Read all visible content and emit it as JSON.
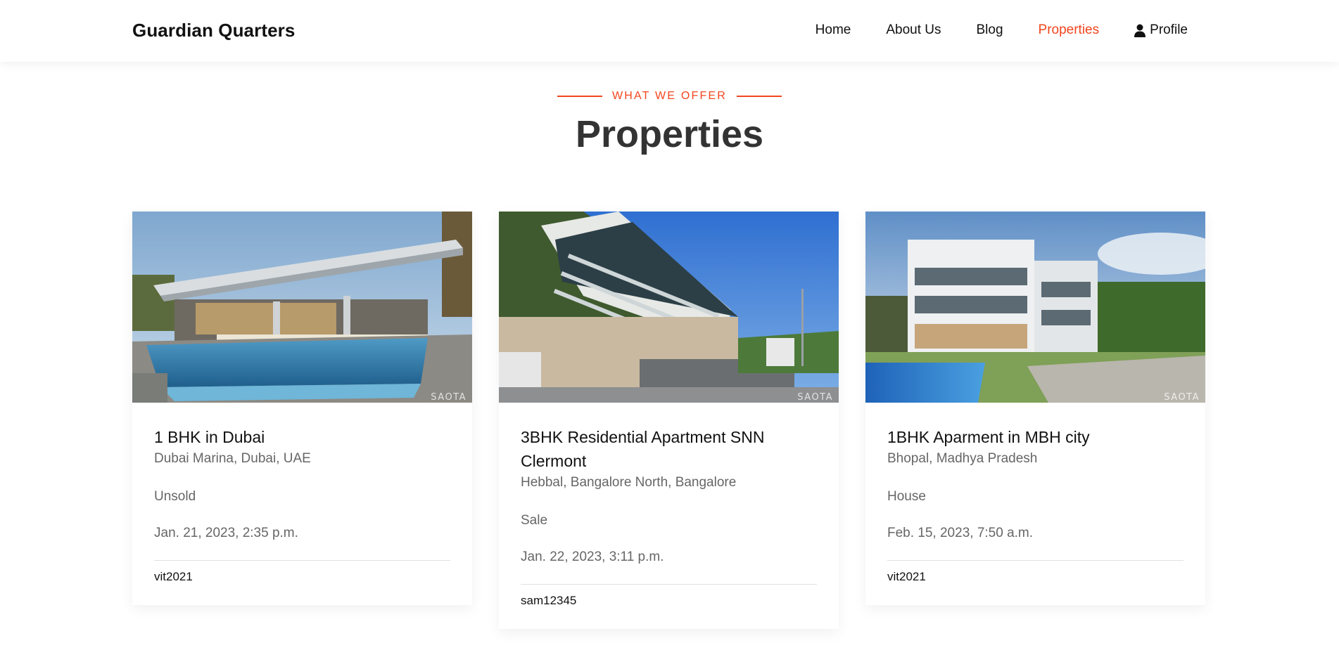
{
  "header": {
    "brand": "Guardian Quarters",
    "nav": [
      {
        "label": "Home"
      },
      {
        "label": "About Us"
      },
      {
        "label": "Blog"
      },
      {
        "label": "Properties"
      },
      {
        "label": "Profile",
        "icon": "user-icon"
      }
    ],
    "active_item": "Properties",
    "accent_color": "#f2461e"
  },
  "section": {
    "eyebrow": "WHAT WE OFFER",
    "title": "Properties"
  },
  "properties": [
    {
      "title": "1 BHK in Dubai",
      "location": "Dubai Marina, Dubai, UAE",
      "type": "Unsold",
      "date": "Jan. 21, 2023, 2:35 p.m.",
      "user": "vit2021",
      "watermark": "SAOTA"
    },
    {
      "title": "3BHK Residential Apartment SNN Clermont",
      "location": "Hebbal, Bangalore North, Bangalore",
      "type": "Sale",
      "date": "Jan. 22, 2023, 3:11 p.m.",
      "user": "sam12345",
      "watermark": "SAOTA"
    },
    {
      "title": "1BHK Aparment in MBH city",
      "location": "Bhopal, Madhya Pradesh",
      "type": "House",
      "date": "Feb. 15, 2023, 7:50 a.m.",
      "user": "vit2021",
      "watermark": "SAOTA"
    }
  ]
}
